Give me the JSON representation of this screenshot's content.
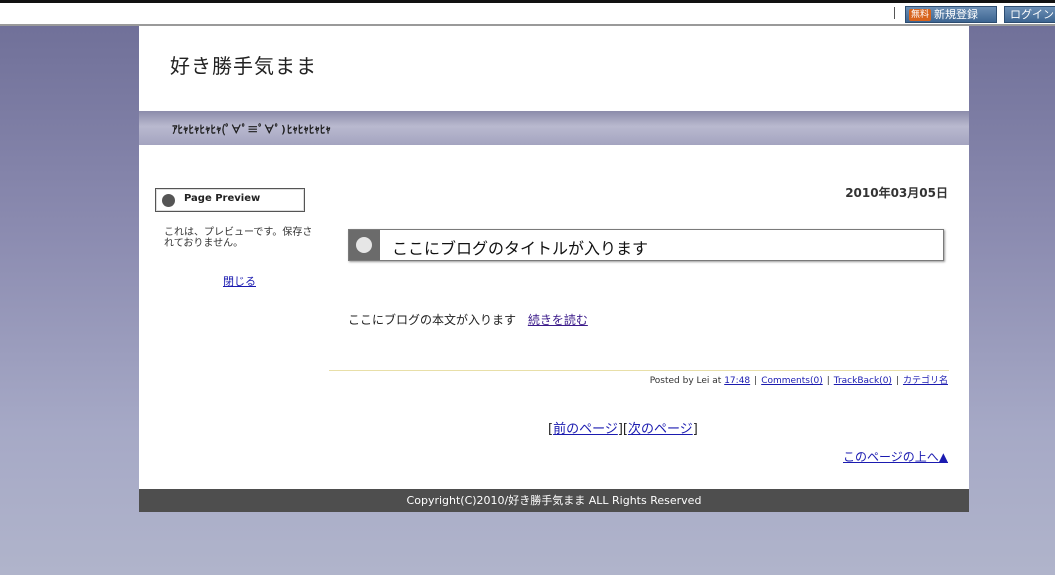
{
  "topbar": {
    "signup_badge": "無料",
    "signup_label": "新規登録",
    "login_label": "ログイン"
  },
  "header": {
    "site_title": "好き勝手気まま",
    "tagline": "ｱﾋｬﾋｬﾋｬﾋｬ(ﾟ∀ﾟ≡ﾟ∀ﾟ)ﾋｬﾋｬﾋｬﾋｬ"
  },
  "sidebar": {
    "preview_title": "Page Preview",
    "preview_message": "これは、プレビューです。保存されておりません。",
    "close_link": "閉じる"
  },
  "entry": {
    "date": "2010年03月05日",
    "title": "ここにブログのタイトルが入ります",
    "body": "ここにブログの本文が入ります",
    "read_more": "続きを読む",
    "posted_by": "Posted by Lei at",
    "time": "17:48",
    "comments": "Comments(0)",
    "trackback": "TrackBack(0)",
    "category": "カテゴリ名"
  },
  "pager": {
    "open_bracket": "[",
    "prev": "前のページ",
    "middle": "][",
    "next": "次のページ",
    "close_bracket": "]",
    "to_top": "このページの上へ▲"
  },
  "footer": {
    "copyright": "Copyright(C)2010/好き勝手気まま ALL Rights Reserved"
  },
  "colors": {
    "background_top": "#6d6d96",
    "background_bottom": "#b0b4cb",
    "footer": "#4e4e4e",
    "link": "#1b1bb0"
  }
}
